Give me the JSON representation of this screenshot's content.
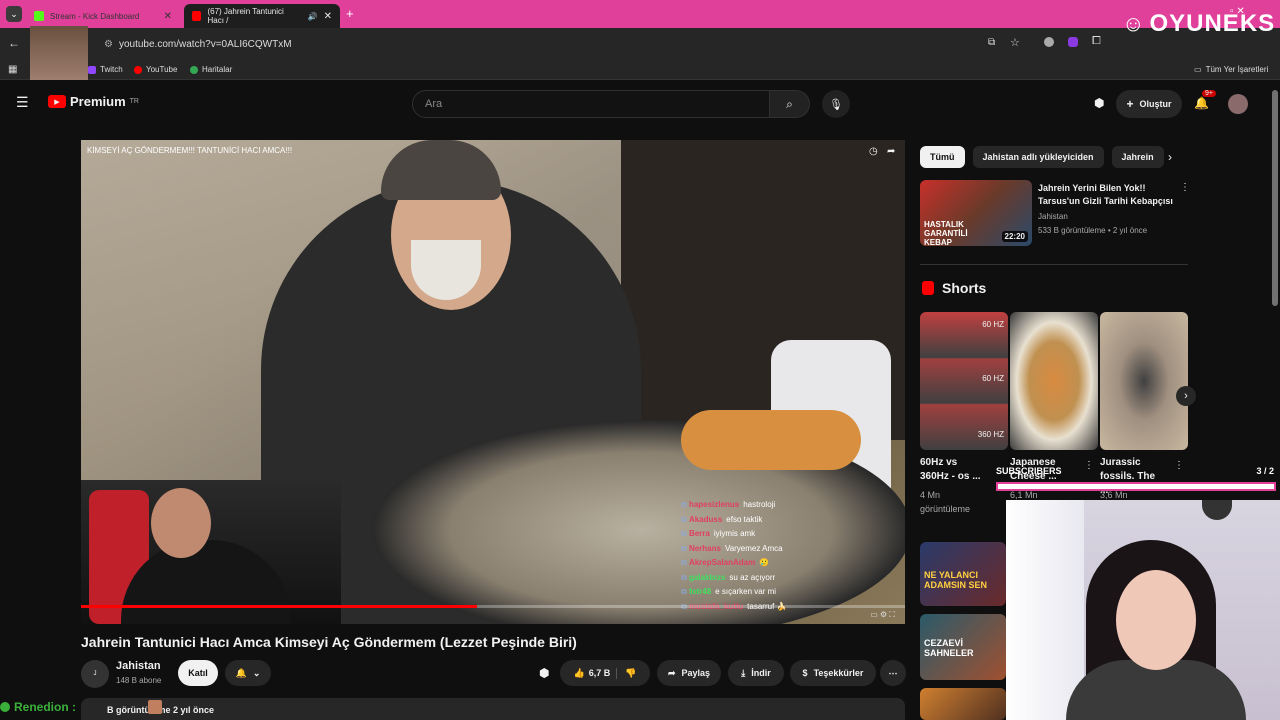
{
  "browser": {
    "tabs": [
      {
        "label": "Stream - Kick Dashboard",
        "color": "#53fc18"
      },
      {
        "label": "(67) Jahrein Tantunici Hacı /",
        "color": "#ff0000"
      }
    ],
    "url": "youtube.com/watch?v=0ALI6CQWTxM",
    "bookmarks": [
      "Twitch",
      "YouTube",
      "Haritalar"
    ],
    "all_bookmarks": "Tüm Yer İşaretleri"
  },
  "youtube": {
    "logo": "Premium",
    "logo_sup": "TR",
    "search_placeholder": "Ara",
    "create_label": "Oluştur",
    "notif_count": "9+"
  },
  "video": {
    "overlay_title": "KİMSEYİ AÇ GÖNDERMEM!!! TANTUNİCİ HACI AMCA!!!",
    "title": "Jahrein Tantunici Hacı Amca Kimseyi Aç Göndermem (Lezzet Peşinde Biri)",
    "progress": 0.48,
    "channel": "Jahistan",
    "subscribers": "148 B abone",
    "join_label": "Katıl",
    "likes": "6,7 B",
    "share_label": "Paylaş",
    "download_label": "İndir",
    "thanks_label": "Teşekkürler",
    "desc_line": "B görüntüleme  2 yıl önce"
  },
  "chat": [
    {
      "user": "hapesizlenus",
      "text": "hastroloji",
      "color": "#e04060"
    },
    {
      "user": "Akaduss",
      "text": "efso taktik",
      "color": "#e04060"
    },
    {
      "user": "Berra",
      "text": "iyiymis amk",
      "color": "#e04060"
    },
    {
      "user": "Nerhans",
      "text": "Varyemez Amca",
      "color": "#e04060"
    },
    {
      "user": "AkrepSalanAdam",
      "text": "🥲",
      "color": "#e04060"
    },
    {
      "user": "galaktozs",
      "text": "su az açıyorr",
      "color": "#40e060"
    },
    {
      "user": "fotr48",
      "text": "e sıçarken var mi",
      "color": "#40e060"
    },
    {
      "user": "mustafa_kutlu",
      "text": "tasarruf 🍌",
      "color": "#e04060"
    }
  ],
  "sidebar": {
    "chips": [
      "Tümü",
      "Jahistan adlı yükleyiciden",
      "Jahrein"
    ],
    "rec": {
      "title": "Jahrein Yerini Bilen Yok!! Tarsus'un Gizli Tarihi Kebapçısı",
      "channel": "Jahistan",
      "meta": "533 B görüntüleme • 2 yıl önce",
      "duration": "22:20",
      "thumb_text": "HASTALIK GARANTİLİ KEBAP"
    },
    "shorts_heading": "Shorts",
    "shorts": [
      {
        "title": "60Hz vs 360Hz - os ...",
        "meta": "4 Mn görüntüleme",
        "labels": [
          "60 HZ",
          "60 HZ",
          "360 HZ"
        ]
      },
      {
        "title": "Japanese Cheese ...",
        "meta": "6,1 Mn"
      },
      {
        "title": "Jurassic fossils. The ...",
        "meta": "3,6 Mn"
      }
    ],
    "more_thumbs": [
      "NE YALANCI ADAMSIN SEN",
      "CEZAEVİ SAHNELER"
    ]
  },
  "overlay": {
    "brand": "OYUNEKS",
    "subs_label": "SUBSCRIBERS",
    "subs_count": "3 / 2",
    "username": "Renedion :"
  }
}
